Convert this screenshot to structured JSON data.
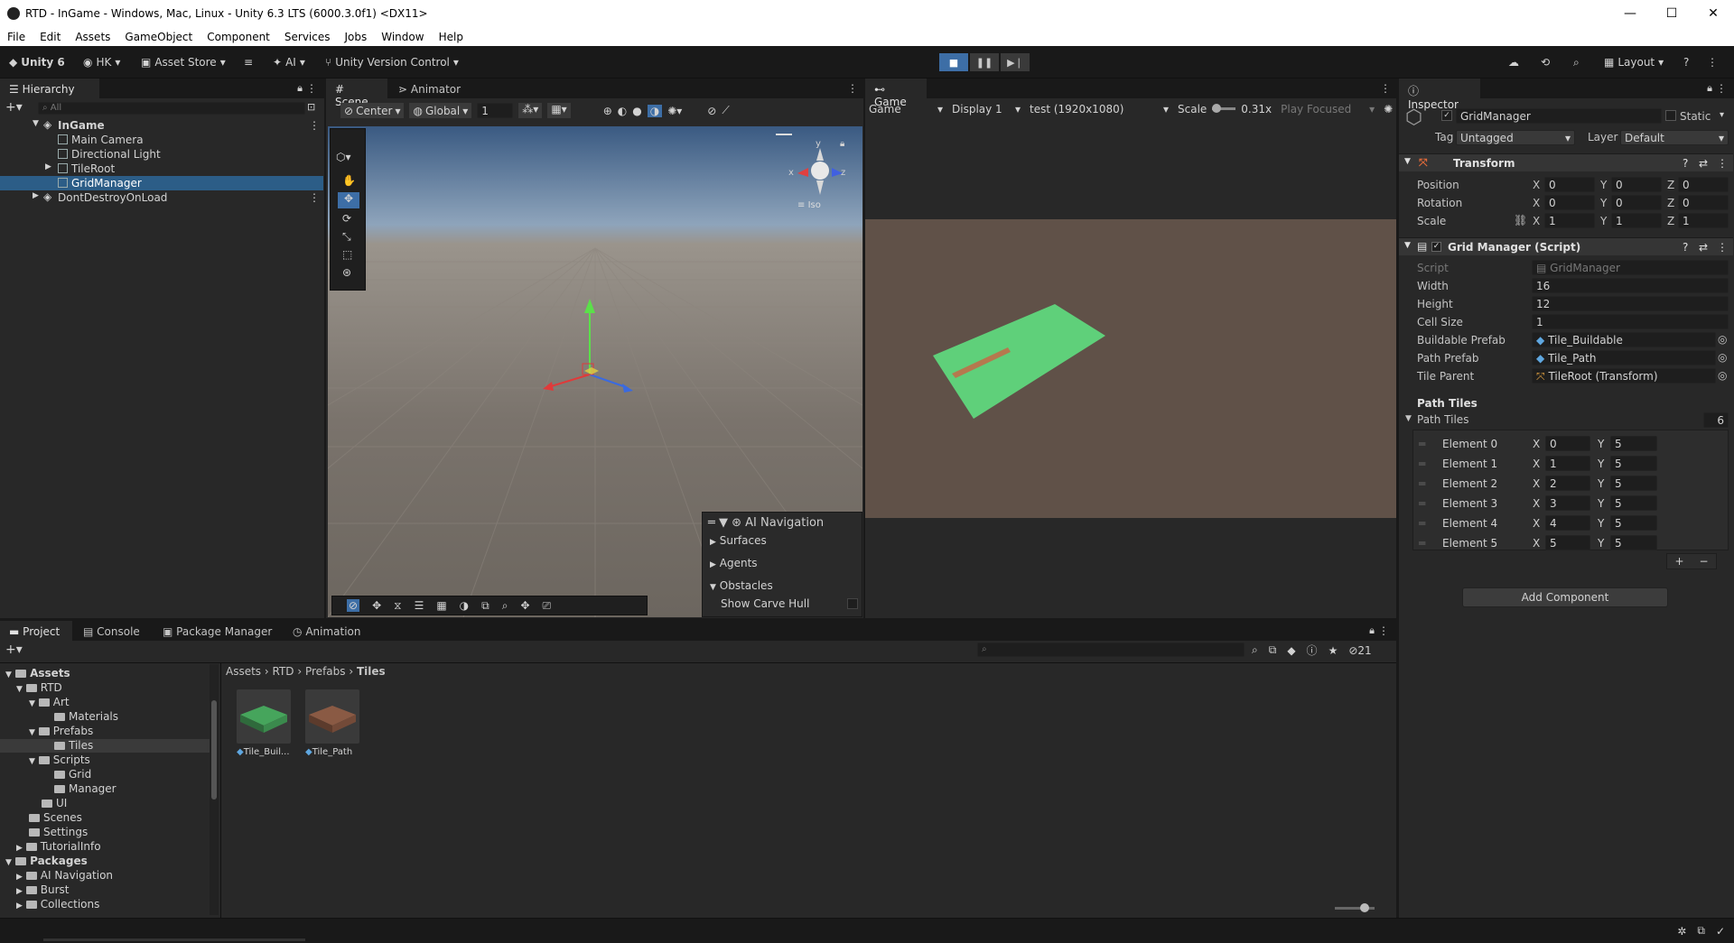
{
  "window": {
    "title": "RTD - InGame - Windows, Mac, Linux - Unity 6.3 LTS (6000.3.0f1) <DX11>",
    "controls": [
      "—",
      "☐",
      "✕"
    ]
  },
  "menu": [
    "File",
    "Edit",
    "Assets",
    "GameObject",
    "Component",
    "Services",
    "Jobs",
    "Window",
    "Help"
  ],
  "toolbar": {
    "unity_label": "Unity 6",
    "account": "HK",
    "asset_store": "Asset Store",
    "ai": "AI",
    "version_control": "Unity Version Control",
    "layout": "Layout"
  },
  "hierarchy": {
    "tab": "Hierarchy",
    "search_placeholder": "All",
    "items": [
      {
        "label": "InGame",
        "depth": 0
      },
      {
        "label": "Main Camera",
        "depth": 1
      },
      {
        "label": "Directional Light",
        "depth": 1
      },
      {
        "label": "TileRoot",
        "depth": 1
      },
      {
        "label": "GridManager",
        "depth": 1,
        "selected": true
      },
      {
        "label": "DontDestroyOnLoad",
        "depth": 0
      }
    ]
  },
  "scene": {
    "tabs": [
      "Scene",
      "Animator"
    ],
    "pivot": "Center",
    "space": "Global",
    "grid_value": "1",
    "gizmo_labels": {
      "y": "y",
      "x": "x",
      "z": "z",
      "mode": "Iso"
    },
    "overlay": {
      "title": "AI Navigation",
      "items": [
        "Surfaces",
        "Agents",
        "Obstacles"
      ],
      "toggle": "Show Carve Hull"
    }
  },
  "game": {
    "tab": "Game",
    "mode": "Game",
    "display": "Display 1",
    "resolution": "test (1920x1080)",
    "scale_label": "Scale",
    "scale_value": "0.31x",
    "play_focused": "Play Focused"
  },
  "inspector": {
    "tab": "Inspector",
    "object_name": "GridManager",
    "static_label": "Static",
    "tag_label": "Tag",
    "tag_value": "Untagged",
    "layer_label": "Layer",
    "layer_value": "Default",
    "transform": {
      "title": "Transform",
      "position": {
        "label": "Position",
        "x": "0",
        "y": "0",
        "z": "0"
      },
      "rotation": {
        "label": "Rotation",
        "x": "0",
        "y": "0",
        "z": "0"
      },
      "scale": {
        "label": "Scale",
        "x": "1",
        "y": "1",
        "z": "1"
      }
    },
    "script_component": {
      "title": "Grid Manager (Script)",
      "fields": [
        {
          "label": "Script",
          "value": "GridManager"
        },
        {
          "label": "Width",
          "value": "16"
        },
        {
          "label": "Height",
          "value": "12"
        },
        {
          "label": "Cell Size",
          "value": "1"
        },
        {
          "label": "Buildable Prefab",
          "value": "Tile_Buildable"
        },
        {
          "label": "Path Prefab",
          "value": "Tile_Path"
        },
        {
          "label": "Tile Parent",
          "value": "TileRoot (Transform)"
        }
      ],
      "section_header": "Path Tiles",
      "list_label": "Path Tiles",
      "list_count": "6",
      "elements": [
        {
          "label": "Element 0",
          "x": "0",
          "y": "5"
        },
        {
          "label": "Element 1",
          "x": "1",
          "y": "5"
        },
        {
          "label": "Element 2",
          "x": "2",
          "y": "5"
        },
        {
          "label": "Element 3",
          "x": "3",
          "y": "5"
        },
        {
          "label": "Element 4",
          "x": "4",
          "y": "5"
        },
        {
          "label": "Element 5",
          "x": "5",
          "y": "5"
        }
      ]
    },
    "add_component": "Add Component"
  },
  "bottom": {
    "tabs": [
      "Project",
      "Console",
      "Package Manager",
      "Animation"
    ],
    "breadcrumb": [
      "Assets",
      "RTD",
      "Prefabs",
      "Tiles"
    ],
    "count": "21",
    "tree": [
      {
        "label": "Assets",
        "depth": 0,
        "bold": true
      },
      {
        "label": "RTD",
        "depth": 1
      },
      {
        "label": "Art",
        "depth": 2
      },
      {
        "label": "Materials",
        "depth": 3
      },
      {
        "label": "Prefabs",
        "depth": 2
      },
      {
        "label": "Tiles",
        "depth": 3,
        "selected": true
      },
      {
        "label": "Scripts",
        "depth": 2
      },
      {
        "label": "Grid",
        "depth": 3
      },
      {
        "label": "Manager",
        "depth": 3
      },
      {
        "label": "UI",
        "depth": 2
      },
      {
        "label": "Scenes",
        "depth": 1
      },
      {
        "label": "Settings",
        "depth": 1
      },
      {
        "label": "TutorialInfo",
        "depth": 1
      },
      {
        "label": "Packages",
        "depth": 0,
        "bold": true
      },
      {
        "label": "AI Navigation",
        "depth": 1
      },
      {
        "label": "Burst",
        "depth": 1
      },
      {
        "label": "Collections",
        "depth": 1
      }
    ],
    "assets": [
      {
        "label": "Tile_Buil...",
        "color": "#3f8f52"
      },
      {
        "label": "Tile_Path",
        "color": "#8a5a44"
      }
    ]
  },
  "colors": {
    "accent": "#2c5d87",
    "play_active": "#3d6ea6",
    "tile_green": "#5fd07a",
    "tile_path": "#b5794e"
  }
}
